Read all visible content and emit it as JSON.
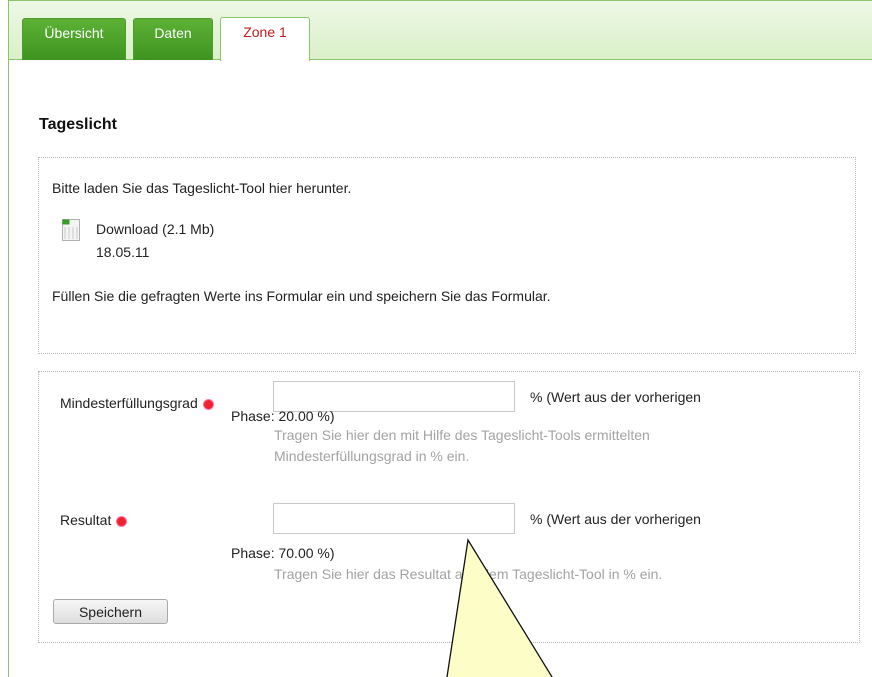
{
  "tabs": [
    {
      "label": "Übersicht"
    },
    {
      "label": "Daten"
    },
    {
      "label": "Zone 1"
    }
  ],
  "section": {
    "title": "Tageslicht"
  },
  "download": {
    "intro": "Bitte laden Sie das Tageslicht-Tool hier herunter.",
    "link_label": "Download (2.1 Mb)",
    "date": "18.05.11",
    "instruction": "Füllen Sie die gefragten Werte ins Formular ein und speichern Sie das Formular."
  },
  "form": {
    "field1": {
      "label": "Mindesterfüllungsgrad",
      "value": "",
      "suffix": "% (Wert aus der vorherigen",
      "phase": "Phase: 20.00 %)",
      "help_line1": "Tragen Sie hier den mit Hilfe des Tageslicht-Tools ermittelten",
      "help_line2": "Mindesterfüllungsgrad in % ein."
    },
    "field2": {
      "label": "Resultat",
      "value": "",
      "suffix": "% (Wert aus der vorherigen",
      "phase": "Phase: 70.00 %)",
      "help_line1": "Tragen Sie hier das Resultat aus dem Tageslicht-Tool in % ein."
    },
    "save_label": "Speichern"
  },
  "colors": {
    "tab_green": "#4fa52c",
    "active_tab_text": "#c11f1f",
    "required": "#ee2233",
    "callout": "#fdfdc8"
  }
}
